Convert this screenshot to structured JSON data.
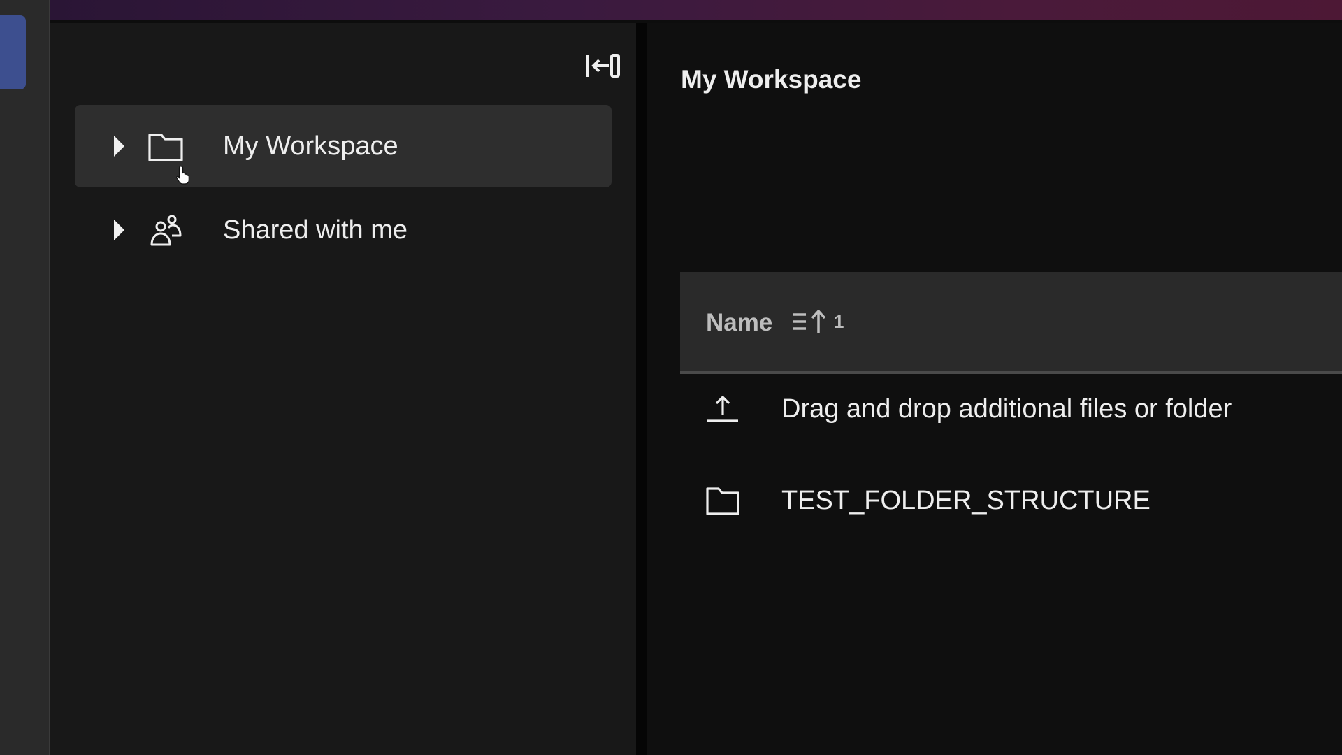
{
  "sidebar": {
    "collapse_icon": "collapse-sidebar-icon",
    "items": [
      {
        "label": "My Workspace",
        "icon": "folder-icon",
        "expand_icon": "caret-right-icon",
        "selected": true
      },
      {
        "label": "Shared with me",
        "icon": "shared-users-icon",
        "expand_icon": "caret-right-icon",
        "selected": false
      }
    ]
  },
  "main": {
    "title": "My Workspace",
    "table": {
      "columns": [
        {
          "label": "Name",
          "sort_icon": "sort-ascending-icon",
          "sort_order": "1"
        }
      ],
      "rows": [
        {
          "label": "Drag and drop additional files or folder",
          "icon": "upload-icon"
        },
        {
          "label": "TEST_FOLDER_STRUCTURE",
          "icon": "folder-icon"
        }
      ]
    }
  },
  "colors": {
    "background": "#0d0d0d",
    "sidebar": "#181818",
    "selected_item": "#2e2e2e",
    "table_header": "#2a2a2a",
    "accent": "#3d4f8f",
    "topbar_gradient_start": "#2a1535",
    "topbar_gradient_end": "#4d1835"
  }
}
